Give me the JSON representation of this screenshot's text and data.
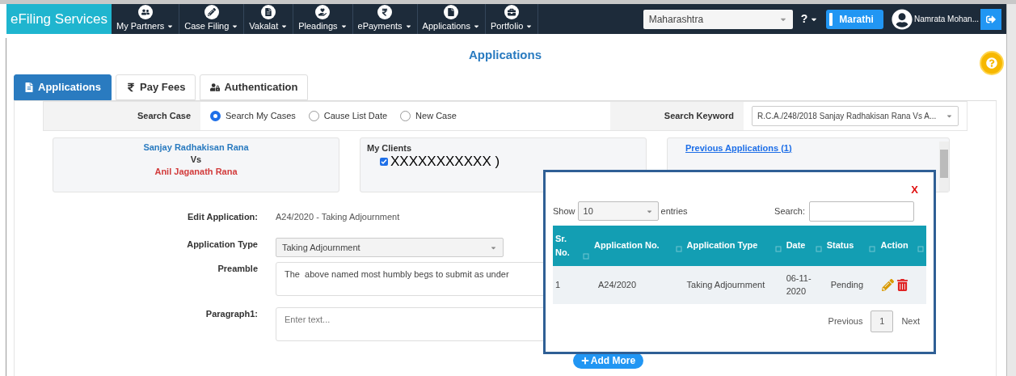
{
  "navbar": {
    "brand": "eFiling Services",
    "menus": [
      {
        "label": "My Partners"
      },
      {
        "label": "Case Filing"
      },
      {
        "label": "Vakalat"
      },
      {
        "label": "Pleadings"
      },
      {
        "label": "ePayments"
      },
      {
        "label": "Applications"
      },
      {
        "label": "Portfolio"
      }
    ],
    "state_select": "Maharashtra",
    "help": "?",
    "language_button": "Marathi",
    "user_name": "Namrata Mohan..."
  },
  "page_title": "Applications",
  "tabs": [
    {
      "label": "Applications",
      "selected": true
    },
    {
      "label": "Pay Fees",
      "selected": false
    },
    {
      "label": "Authentication",
      "selected": false
    }
  ],
  "search": {
    "label": "Search Case",
    "options": [
      {
        "label": "Search My Cases",
        "selected": true
      },
      {
        "label": "Cause List Date",
        "selected": false
      },
      {
        "label": "New Case",
        "selected": false
      }
    ],
    "keyword_label": "Search Keyword",
    "keyword_value": "R.C.A./248/2018 Sanjay Radhakisan Rana Vs A..."
  },
  "parties": {
    "petitioner": "Sanjay Radhakisan Rana",
    "vs": "Vs",
    "respondent": "Anil Jaganath Rana"
  },
  "clients": {
    "title": "My Clients",
    "items": [
      {
        "label": "XXXXXXXXXXX )",
        "checked": true
      }
    ]
  },
  "previous_applications_link": "Previous Applications (1)",
  "form": {
    "edit_label": "Edit Application:",
    "edit_value": "A24/2020 - Taking Adjournment",
    "type_label": "Application Type",
    "type_value": "Taking Adjournment",
    "preamble_label": "Preamble",
    "preamble_value": "The  above named most humbly begs to submit as under",
    "paragraph_label": "Paragraph1:",
    "paragraph_placeholder": "Enter text...",
    "add_more": "Add More"
  },
  "modal": {
    "close": "X",
    "show_label": "Show",
    "page_size": "10",
    "entries_label": "entries",
    "search_label": "Search:",
    "columns": [
      "Sr. No.",
      "Application No.",
      "Application Type",
      "Date",
      "Status",
      "Action"
    ],
    "rows": [
      {
        "sr": "1",
        "number": "A24/2020",
        "type": "Taking Adjournment",
        "date": "06-11-2020",
        "status": "Pending"
      }
    ],
    "pagination": {
      "previous": "Previous",
      "pages": [
        {
          "label": "1",
          "selected": true
        }
      ],
      "next": "Next"
    }
  }
}
